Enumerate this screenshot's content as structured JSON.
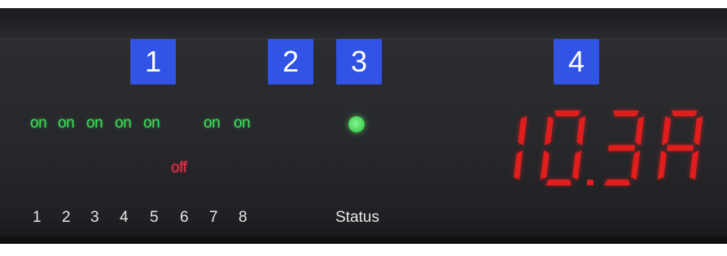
{
  "badges": {
    "one": "1",
    "two": "2",
    "three": "3",
    "four": "4"
  },
  "outputs": {
    "on_label": "on",
    "off_label": "off",
    "channels": [
      {
        "number": "1",
        "state": "on"
      },
      {
        "number": "2",
        "state": "on"
      },
      {
        "number": "3",
        "state": "on"
      },
      {
        "number": "4",
        "state": "on"
      },
      {
        "number": "5",
        "state": "on"
      },
      {
        "number": "6",
        "state": "off"
      },
      {
        "number": "7",
        "state": "on"
      },
      {
        "number": "8",
        "state": "on"
      }
    ]
  },
  "status": {
    "label": "Status",
    "led_color": "#4fd85e"
  },
  "display": {
    "reading": "10.3A",
    "color": "#e11d1d"
  },
  "colors": {
    "badge": "#3154e6",
    "on": "#3ddc5a",
    "off": "#e0324a",
    "panel": "#27282b"
  }
}
